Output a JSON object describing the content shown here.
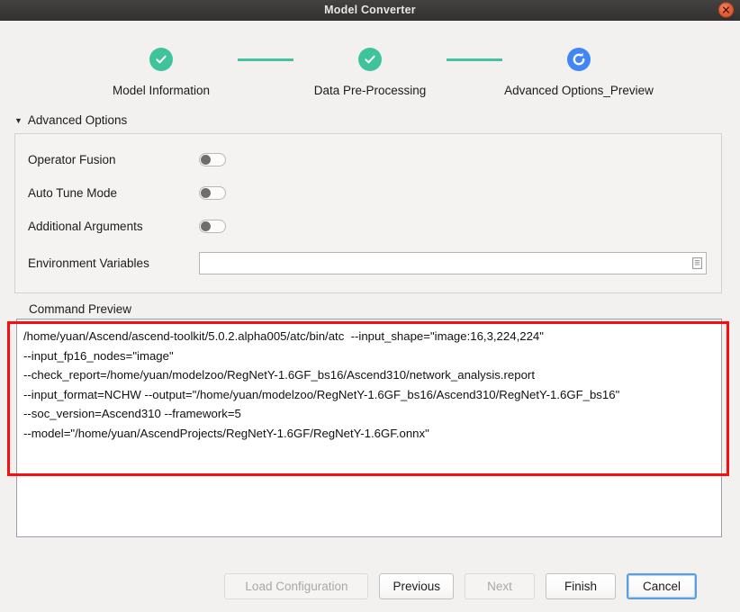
{
  "window": {
    "title": "Model Converter",
    "close_icon": "close-icon"
  },
  "stepper": {
    "steps": [
      {
        "label": "Model Information",
        "state": "done",
        "icon": "check-circle-icon"
      },
      {
        "label": "Data Pre-Processing",
        "state": "done",
        "icon": "check-circle-icon"
      },
      {
        "label": "Advanced Options_Preview",
        "state": "active",
        "icon": "refresh-circle-icon"
      }
    ],
    "colors": {
      "done": "#3ec39b",
      "active": "#4285f4",
      "connector": "#45c2a0"
    }
  },
  "advanced_options": {
    "caret": "▼",
    "title": "Advanced Options",
    "toggles": [
      {
        "label": "Operator Fusion",
        "value": "off"
      },
      {
        "label": "Auto Tune Mode",
        "value": "off"
      },
      {
        "label": "Additional Arguments",
        "value": "off"
      }
    ],
    "environment_variables": {
      "label": "Environment Variables",
      "value": "",
      "placeholder": "",
      "icon": "document-list-icon"
    }
  },
  "command_preview": {
    "label": "Command Preview",
    "value": "/home/yuan/Ascend/ascend-toolkit/5.0.2.alpha005/atc/bin/atc  --input_shape=\"image:16,3,224,224\"\n--input_fp16_nodes=\"image\"\n--check_report=/home/yuan/modelzoo/RegNetY-1.6GF_bs16/Ascend310/network_analysis.report\n--input_format=NCHW --output=\"/home/yuan/modelzoo/RegNetY-1.6GF_bs16/Ascend310/RegNetY-1.6GF_bs16\"\n--soc_version=Ascend310 --framework=5\n--model=\"/home/yuan/AscendProjects/RegNetY-1.6GF/RegNetY-1.6GF.onnx\"",
    "lines": [
      "/home/yuan/Ascend/ascend-toolkit/5.0.2.alpha005/atc/bin/atc  --input_shape=\"image:16,3,224,224\"",
      "--input_fp16_nodes=\"image\"",
      "--check_report=/home/yuan/modelzoo/RegNetY-1.6GF_bs16/Ascend310/network_analysis.report",
      "--input_format=NCHW --output=\"/home/yuan/modelzoo/RegNetY-1.6GF_bs16/Ascend310/RegNetY-1.6GF_bs16\"",
      "--soc_version=Ascend310 --framework=5",
      "--model=\"/home/yuan/AscendProjects/RegNetY-1.6GF/RegNetY-1.6GF.onnx\""
    ],
    "highlight_color": "#fb0d0d"
  },
  "footer": {
    "buttons": [
      {
        "label": "Load Configuration",
        "state": "disabled"
      },
      {
        "label": "Previous",
        "state": "enabled"
      },
      {
        "label": "Next",
        "state": "disabled"
      },
      {
        "label": "Finish",
        "state": "enabled"
      },
      {
        "label": "Cancel",
        "state": "focused"
      }
    ]
  }
}
